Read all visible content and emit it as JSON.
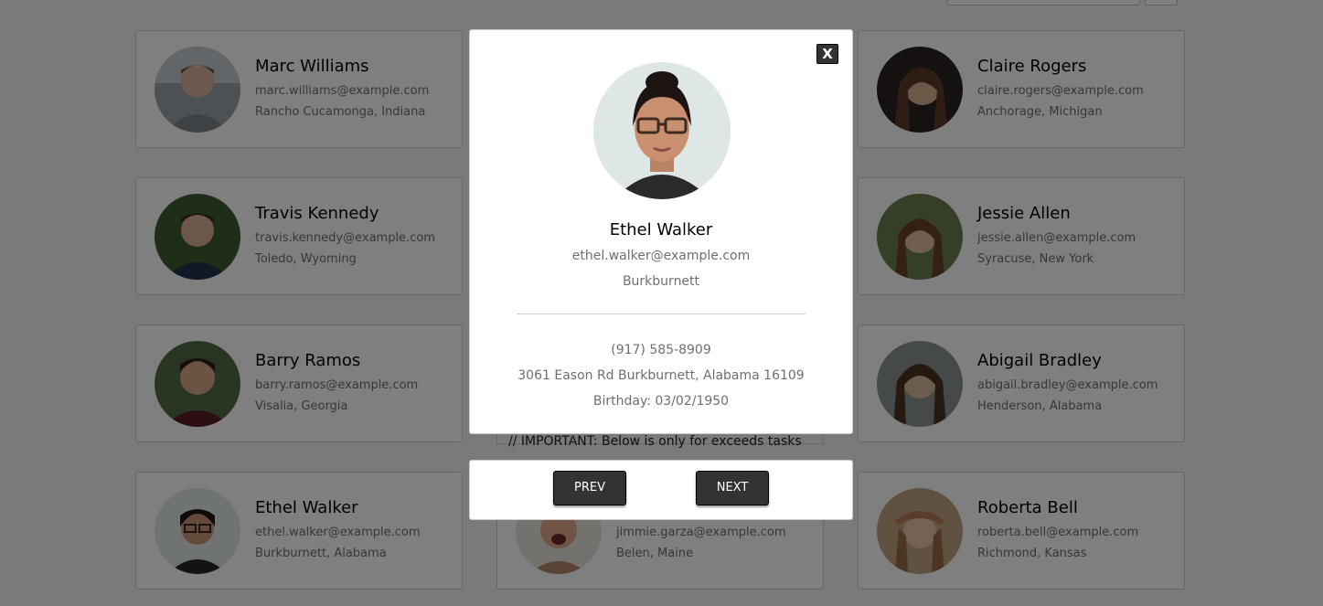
{
  "background": {
    "employees": [
      {
        "name": "Marc Williams",
        "email": "marc.williams@example.com",
        "location": "Rancho Cucamonga, Indiana",
        "avatar": "man-portrait"
      },
      {
        "name": "Claire Rogers",
        "email": "claire.rogers@example.com",
        "location": "Anchorage, Michigan",
        "avatar": "woman-portrait"
      },
      {
        "name": "Travis Kennedy",
        "email": "travis.kennedy@example.com",
        "location": "Toledo, Wyoming",
        "avatar": "man-portrait"
      },
      {
        "name": "Jessie Allen",
        "email": "jessie.allen@example.com",
        "location": "Syracuse, New York",
        "avatar": "woman-portrait"
      },
      {
        "name": "Barry Ramos",
        "email": "barry.ramos@example.com",
        "location": "Visalia, Georgia",
        "avatar": "man-portrait"
      },
      {
        "name": "Abigail Bradley",
        "email": "abigail.bradley@example.com",
        "location": "Henderson, Alabama",
        "avatar": "woman-portrait"
      },
      {
        "name": "Ethel Walker",
        "email": "ethel.walker@example.com",
        "location": "Burkburnett, Alabama",
        "avatar": "woman-portrait"
      },
      {
        "name": "",
        "email": "jimmie.garza@example.com",
        "location": "Belen, Maine",
        "avatar": "man-portrait"
      },
      {
        "name": "Roberta Bell",
        "email": "roberta.bell@example.com",
        "location": "Richmond, Kansas",
        "avatar": "woman-portrait"
      }
    ],
    "note_text": "// IMPORTANT: Below is only for exceeds tasks"
  },
  "modal": {
    "close_label": "X",
    "name": "Ethel Walker",
    "email": "ethel.walker@example.com",
    "city": "Burkburnett",
    "phone": "(917) 585-8909",
    "address": "3061 Eason Rd Burkburnett, Alabama 16109",
    "birthday": "Birthday: 03/02/1950"
  },
  "nav": {
    "prev_label": "PREV",
    "next_label": "NEXT"
  },
  "colors": {
    "overlay": "#000000",
    "button_bg": "#333333",
    "muted_text": "#6f6f6f"
  }
}
